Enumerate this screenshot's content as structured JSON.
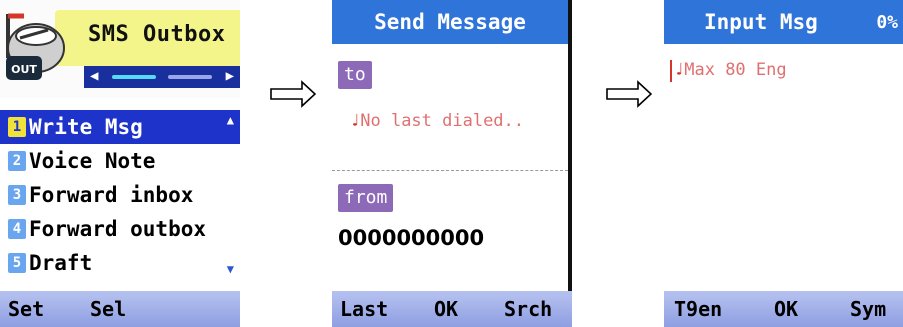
{
  "screen1": {
    "title": "SMS Outbox",
    "icon_label": "OUT",
    "menu_items": [
      {
        "num": "1",
        "label": "Write Msg"
      },
      {
        "num": "2",
        "label": "Voice Note"
      },
      {
        "num": "3",
        "label": "Forward inbox"
      },
      {
        "num": "4",
        "label": "Forward outbox"
      },
      {
        "num": "5",
        "label": "Draft"
      }
    ],
    "softkeys": {
      "left": "Set",
      "center": "Sel"
    }
  },
  "screen2": {
    "title": "Send Message",
    "to_label": "to",
    "to_hint": "No last dialed..",
    "from_label": "from",
    "from_value": "0000000000",
    "softkeys": {
      "left": "Last",
      "center": "OK",
      "right": "Srch"
    }
  },
  "screen3": {
    "title": "Input Msg",
    "counter": "0%",
    "hint": "Max 80 Eng",
    "softkeys": {
      "left": "T9en",
      "center": "OK",
      "right": "Sym"
    }
  },
  "colors": {
    "title_blue": "#2f74d8",
    "selection_blue": "#1e33c9",
    "header_yellow": "#f3f58a",
    "tag_purple": "#8d6ab8",
    "hint_pink": "#e07070"
  }
}
